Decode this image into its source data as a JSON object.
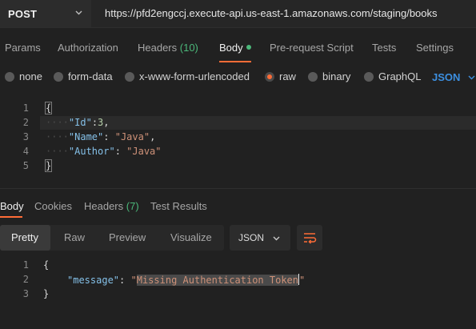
{
  "request": {
    "method": "POST",
    "url": "https://pfd2engccj.execute-api.us-east-1.amazonaws.com/staging/books"
  },
  "tabs": {
    "params": "Params",
    "authorization": "Authorization",
    "headers": "Headers",
    "headers_count": "(10)",
    "body": "Body",
    "pre_request": "Pre-request Script",
    "tests": "Tests",
    "settings": "Settings"
  },
  "body_types": {
    "none": "none",
    "form_data": "form-data",
    "urlencoded": "x-www-form-urlencoded",
    "raw": "raw",
    "binary": "binary",
    "graphql": "GraphQL",
    "language": "JSON",
    "selected": "raw"
  },
  "request_body": {
    "line_numbers": [
      "1",
      "2",
      "3",
      "4",
      "5"
    ],
    "open_brace": "{",
    "close_brace": "}",
    "id_key": "\"Id\"",
    "id_value": "3",
    "name_key": "\"Name\"",
    "name_value": "\"Java\"",
    "author_key": "\"Author\"",
    "author_value": "\"Java\""
  },
  "response_tabs": {
    "body": "Body",
    "cookies": "Cookies",
    "headers": "Headers",
    "headers_count": "(7)",
    "test_results": "Test Results"
  },
  "response_view": {
    "pretty": "Pretty",
    "raw": "Raw",
    "preview": "Preview",
    "visualize": "Visualize",
    "format": "JSON",
    "selected": "Pretty"
  },
  "response_body": {
    "line_numbers": [
      "1",
      "2",
      "3"
    ],
    "open_brace": "{",
    "close_brace": "}",
    "message_key": "\"message\"",
    "message_value": "Missing Authentication Token"
  },
  "icons": {
    "method_dropdown": "chevron-down-icon",
    "language_dropdown": "chevron-down-icon",
    "format_dropdown": "chevron-down-icon",
    "wrap": "wrap-lines-icon"
  },
  "colors": {
    "accent": "#ff6c37",
    "count_green": "#4bb87a",
    "json_blue": "#3c8fe0"
  }
}
